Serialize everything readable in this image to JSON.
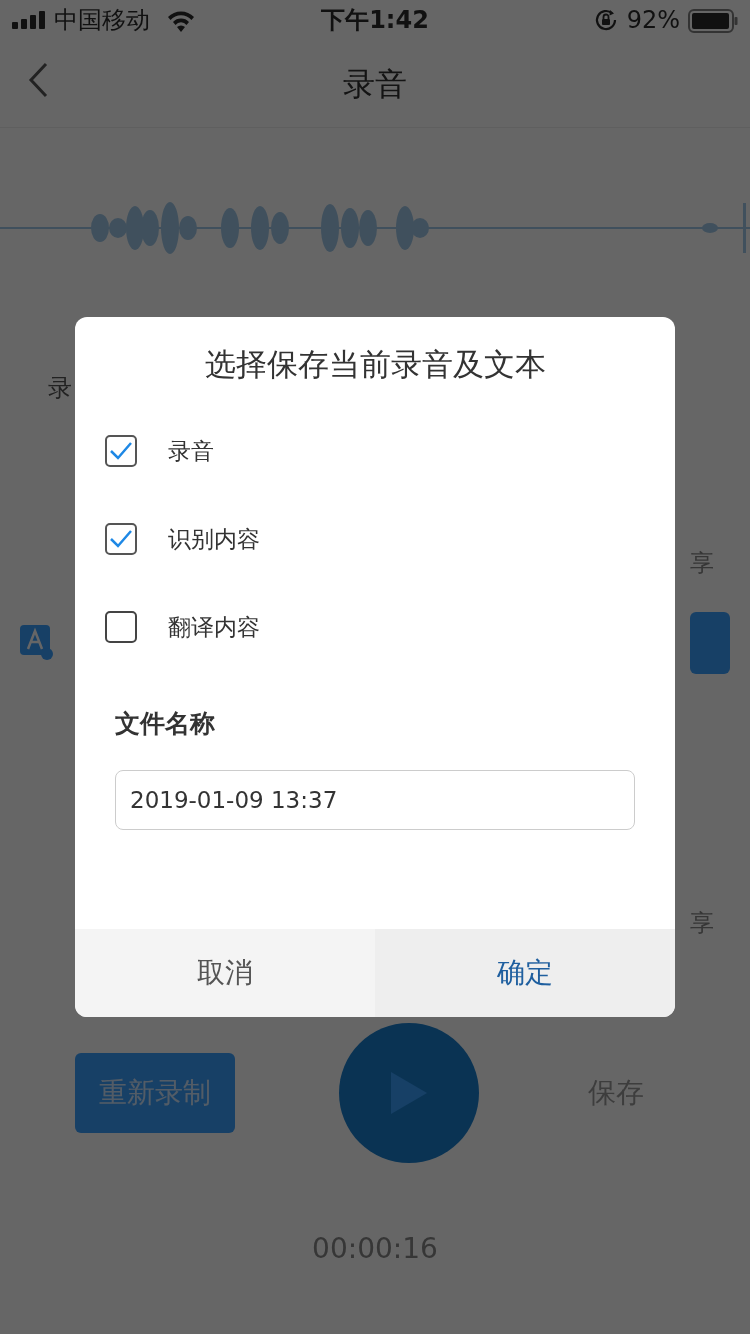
{
  "status_bar": {
    "carrier": "中国移动",
    "time": "下午1:42",
    "battery": "92%"
  },
  "screen": {
    "title": "录音",
    "cut_label": "录",
    "share_labels": [
      "享",
      "享"
    ],
    "controls": [
      {
        "kind": "primary",
        "label": "重新录制"
      },
      {
        "kind": "play"
      },
      {
        "kind": "plain",
        "label": "保存"
      }
    ],
    "timer": "00:00:16"
  },
  "dialog": {
    "title": "选择保存当前录音及文本",
    "options": [
      {
        "label": "录音",
        "checked": true
      },
      {
        "label": "识别内容",
        "checked": true
      },
      {
        "label": "翻译内容",
        "checked": false
      }
    ],
    "field_label": "文件名称",
    "file_name": {
      "value": "2019-01-09 13:37"
    },
    "buttons": [
      {
        "kind": "cancel",
        "label": "取消"
      },
      {
        "kind": "confirm",
        "label": "确定"
      }
    ]
  }
}
